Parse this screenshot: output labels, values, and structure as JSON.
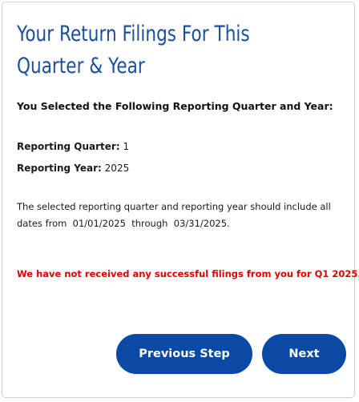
{
  "page": {
    "title": "Your Return Filings For This Quarter & Year",
    "subtitle": "You Selected the Following Reporting Quarter and Year:"
  },
  "selection": {
    "quarter_label": "Reporting Quarter:",
    "quarter_value": "1",
    "year_label": "Reporting Year:",
    "year_value": "2025"
  },
  "info": {
    "text": "The selected reporting quarter and reporting year should include all dates from  01/01/2025  through  03/31/2025."
  },
  "alert": {
    "text": "We have not received any successful filings from you for Q1 2025.",
    "color": "#e00000"
  },
  "buttons": {
    "previous_label": "Previous Step",
    "next_label": "Next",
    "color": "#0a4aa6"
  },
  "theme": {
    "title_color": "#1b4f9b"
  }
}
